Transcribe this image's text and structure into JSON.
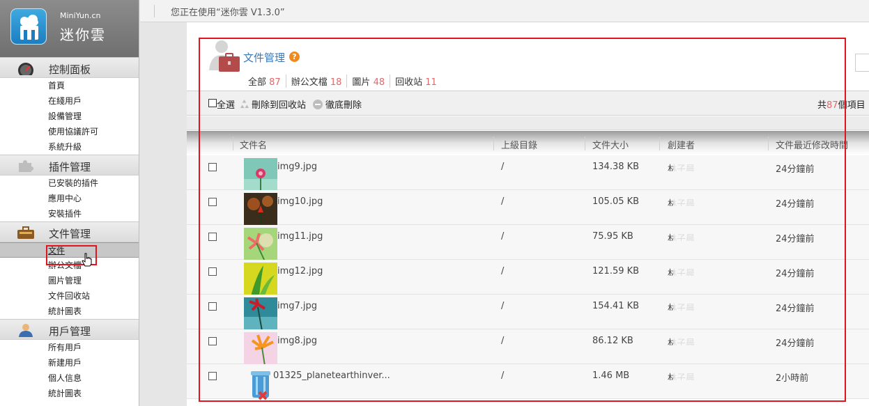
{
  "brand": {
    "sub": "MiniYun.cn",
    "title": "迷你雲"
  },
  "topbar": {
    "version_text": "您正在使用“迷你雲 V1.3.0”"
  },
  "sidebar": {
    "sections": [
      {
        "title": "控制面板",
        "icon": "gauge-icon",
        "items": [
          "首頁",
          "在綫用戶",
          "設備管理",
          "使用協議許可",
          "系統升級"
        ]
      },
      {
        "title": "插件管理",
        "icon": "puzzle-icon",
        "items": [
          "已安裝的插件",
          "應用中心",
          "安裝插件"
        ]
      },
      {
        "title": "文件管理",
        "icon": "briefcase-icon",
        "items": [
          "文件",
          "辦公文檔",
          "圖片管理",
          "文件回收站",
          "統計圖表"
        ],
        "active": "文件"
      },
      {
        "title": "用戶管理",
        "icon": "user-icon",
        "items": [
          "所有用戶",
          "新建用戶",
          "個人信息",
          "統計圖表"
        ]
      }
    ]
  },
  "main": {
    "title": "文件管理",
    "filters": [
      {
        "label": "全部",
        "count": "87"
      },
      {
        "label": "辦公文檔",
        "count": "18"
      },
      {
        "label": "圖片",
        "count": "48"
      },
      {
        "label": "回收站",
        "count": "11"
      }
    ],
    "toolbar": {
      "select_all": "全選",
      "move_to_recycle": "刪除到回收站",
      "delete_permanently": "徹底刪除",
      "total_prefix": "共",
      "total_count": "87",
      "total_suffix": "個項目"
    },
    "columns": [
      "文件名",
      "上級目錄",
      "文件大小",
      "創建者",
      "文件最近修改時間"
    ],
    "rows": [
      {
        "name": "img9.jpg",
        "parent": "/",
        "size": "134.38 KB",
        "creator": "林子晨",
        "modified": "24分鐘前",
        "thumb": "pink-flower-teal"
      },
      {
        "name": "img10.jpg",
        "parent": "/",
        "size": "105.05 KB",
        "creator": "林子晨",
        "modified": "24分鐘前",
        "thumb": "red-flower-dark"
      },
      {
        "name": "img11.jpg",
        "parent": "/",
        "size": "75.95 KB",
        "creator": "林子晨",
        "modified": "24分鐘前",
        "thumb": "pink-flower-green"
      },
      {
        "name": "img12.jpg",
        "parent": "/",
        "size": "121.59 KB",
        "creator": "林子晨",
        "modified": "24分鐘前",
        "thumb": "green-leaves-yellow"
      },
      {
        "name": "img7.jpg",
        "parent": "/",
        "size": "154.41 KB",
        "creator": "林子晨",
        "modified": "24分鐘前",
        "thumb": "red-flower-teal"
      },
      {
        "name": "img8.jpg",
        "parent": "/",
        "size": "86.12 KB",
        "creator": "林子晨",
        "modified": "24分鐘前",
        "thumb": "orange-flower-pink"
      },
      {
        "name": "01325_planetearthinver...",
        "parent": "/",
        "size": "1.46 MB",
        "creator": "林子晨",
        "modified": "2小時前",
        "thumb": "recycle-bin-icon"
      }
    ]
  },
  "colors": {
    "accent_link": "#3a78b8",
    "count_red": "#e06a6a",
    "highlight_red": "#e0141e"
  }
}
